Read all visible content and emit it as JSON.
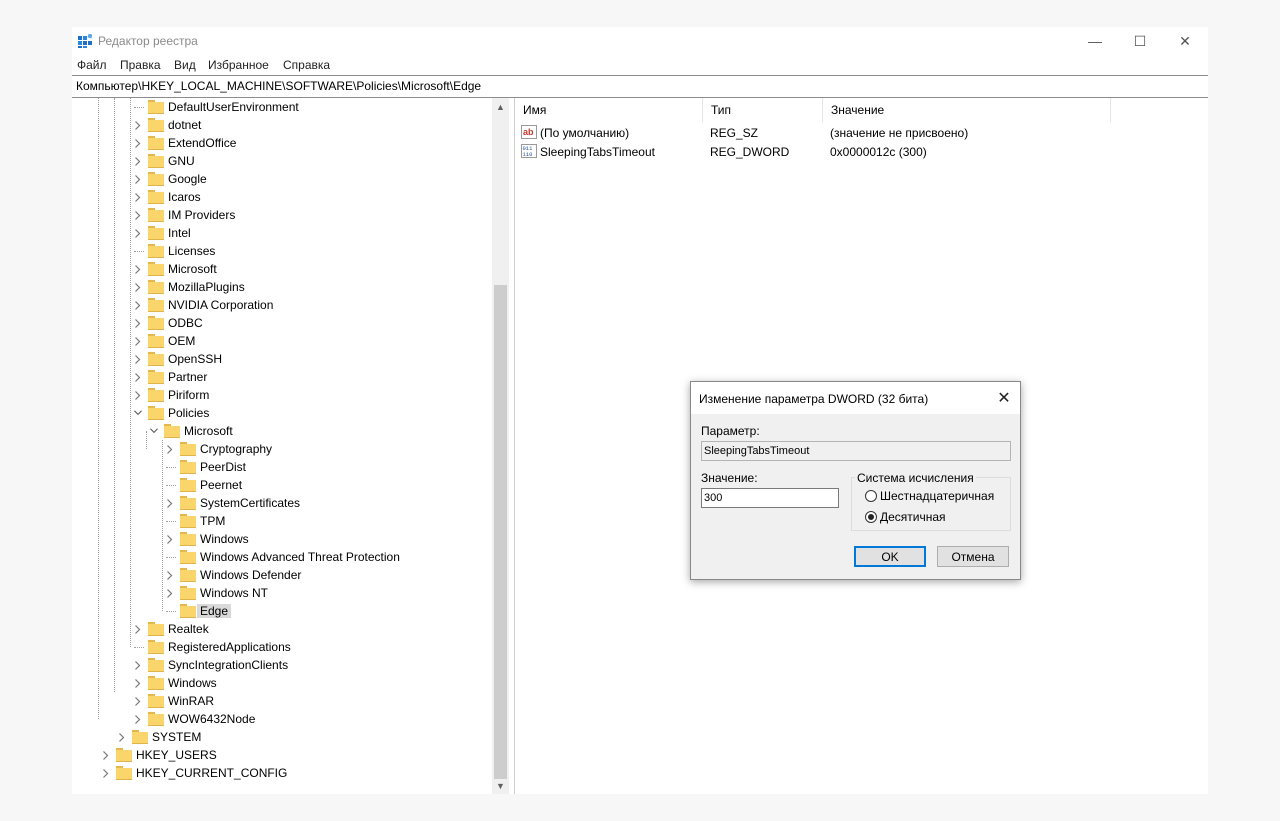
{
  "window": {
    "title": "Редактор реестра",
    "controls": {
      "minimize": "—",
      "maximize": "☐",
      "close": "✕"
    }
  },
  "menu": [
    "Файл",
    "Правка",
    "Вид",
    "Избранное",
    "Справка"
  ],
  "address": "Компьютер\\HKEY_LOCAL_MACHINE\\SOFTWARE\\Policies\\Microsoft\\Edge",
  "tree": {
    "software_children": [
      {
        "label": "DefaultUserEnvironment",
        "expandable": false
      },
      {
        "label": "dotnet",
        "expandable": true
      },
      {
        "label": "ExtendOffice",
        "expandable": true
      },
      {
        "label": "GNU",
        "expandable": true
      },
      {
        "label": "Google",
        "expandable": true
      },
      {
        "label": "Icaros",
        "expandable": true
      },
      {
        "label": "IM Providers",
        "expandable": true
      },
      {
        "label": "Intel",
        "expandable": true
      },
      {
        "label": "Licenses",
        "expandable": false
      },
      {
        "label": "Microsoft",
        "expandable": true
      },
      {
        "label": "MozillaPlugins",
        "expandable": true
      },
      {
        "label": "NVIDIA Corporation",
        "expandable": true
      },
      {
        "label": "ODBC",
        "expandable": true
      },
      {
        "label": "OEM",
        "expandable": true
      },
      {
        "label": "OpenSSH",
        "expandable": true
      },
      {
        "label": "Partner",
        "expandable": true
      },
      {
        "label": "Piriform",
        "expandable": true
      },
      {
        "label": "Policies",
        "expandable": true,
        "expanded": true
      }
    ],
    "policies_child": "Microsoft",
    "microsoft_children": [
      {
        "label": "Cryptography",
        "expandable": true
      },
      {
        "label": "PeerDist",
        "expandable": false
      },
      {
        "label": "Peernet",
        "expandable": false
      },
      {
        "label": "SystemCertificates",
        "expandable": true
      },
      {
        "label": "TPM",
        "expandable": false
      },
      {
        "label": "Windows",
        "expandable": true
      },
      {
        "label": "Windows Advanced Threat Protection",
        "expandable": false
      },
      {
        "label": "Windows Defender",
        "expandable": true
      },
      {
        "label": "Windows NT",
        "expandable": true
      },
      {
        "label": "Edge",
        "expandable": false,
        "selected": true
      }
    ],
    "software_children_after": [
      {
        "label": "Realtek",
        "expandable": true
      },
      {
        "label": "RegisteredApplications",
        "expandable": false
      },
      {
        "label": "SyncIntegrationClients",
        "expandable": true
      },
      {
        "label": "Windows",
        "expandable": true
      },
      {
        "label": "WinRAR",
        "expandable": true
      },
      {
        "label": "WOW6432Node",
        "expandable": true
      }
    ],
    "root_level": [
      {
        "label": "SYSTEM",
        "level": 1
      },
      {
        "label": "HKEY_USERS",
        "level": 0
      },
      {
        "label": "HKEY_CURRENT_CONFIG",
        "level": 0
      }
    ]
  },
  "list": {
    "columns": {
      "name": "Имя",
      "type": "Тип",
      "value": "Значение"
    },
    "rows": [
      {
        "icon": "string-value-icon",
        "name": "(По умолчанию)",
        "type": "REG_SZ",
        "value": "(значение не присвоено)"
      },
      {
        "icon": "binary-value-icon",
        "name": "SleepingTabsTimeout",
        "type": "REG_DWORD",
        "value": "0x0000012c (300)"
      }
    ]
  },
  "dialog": {
    "title": "Изменение параметра DWORD (32 бита)",
    "param_label": "Параметр:",
    "param_value": "SleepingTabsTimeout",
    "value_label": "Значение:",
    "value": "300",
    "base_group": "Система исчисления",
    "radio_hex": "Шестнадцатеричная",
    "radio_dec": "Десятичная",
    "selected_base": "dec",
    "ok": "OK",
    "cancel": "Отмена"
  },
  "colors": {
    "folder": "#f9d56b",
    "accent": "#0078d7"
  }
}
